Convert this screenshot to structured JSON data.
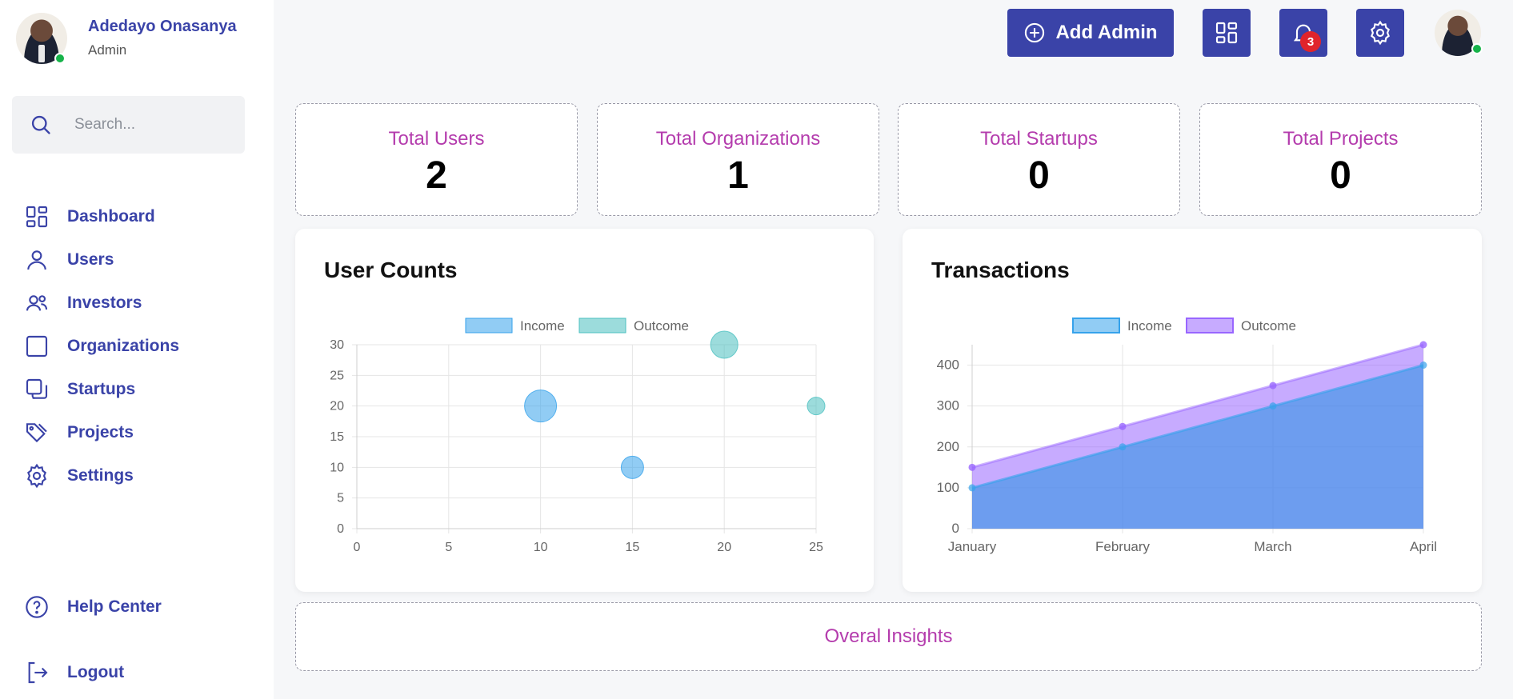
{
  "profile": {
    "name": "Adedayo Onasanya",
    "role": "Admin"
  },
  "search": {
    "placeholder": "Search..."
  },
  "nav": [
    {
      "label": "Dashboard",
      "icon": "dashboard-icon"
    },
    {
      "label": "Users",
      "icon": "user-icon"
    },
    {
      "label": "Investors",
      "icon": "investors-icon"
    },
    {
      "label": "Organizations",
      "icon": "square-icon"
    },
    {
      "label": "Startups",
      "icon": "copy-icon"
    },
    {
      "label": "Projects",
      "icon": "tags-icon"
    },
    {
      "label": "Settings",
      "icon": "gear-icon"
    }
  ],
  "bottom_nav": {
    "help": "Help Center",
    "logout": "Logout"
  },
  "topbar": {
    "add_admin": "Add Admin",
    "notification_count": "3"
  },
  "stats": [
    {
      "label": "Total Users",
      "value": "2"
    },
    {
      "label": "Total Organizations",
      "value": "1"
    },
    {
      "label": "Total Startups",
      "value": "0"
    },
    {
      "label": "Total Projects",
      "value": "0"
    }
  ],
  "insights": {
    "label": "Overal Insights"
  },
  "colors": {
    "accent": "#3a43a8",
    "magenta": "#b43cad",
    "income": "#36a2eb",
    "outcome": "#4bc0c0",
    "outcome_area": "#9966ff"
  },
  "chart_data": [
    {
      "type": "scatter",
      "title": "User Counts",
      "xlim": [
        0,
        25
      ],
      "ylim": [
        0,
        30
      ],
      "xticks": [
        0,
        5,
        10,
        15,
        20,
        25
      ],
      "yticks": [
        0,
        5,
        10,
        15,
        20,
        25,
        30
      ],
      "legend": "top-center",
      "grid": true,
      "series": [
        {
          "name": "Income",
          "points": [
            {
              "x": 10,
              "y": 20,
              "r": 20
            },
            {
              "x": 15,
              "y": 10,
              "r": 14
            }
          ]
        },
        {
          "name": "Outcome",
          "points": [
            {
              "x": 20,
              "y": 30,
              "r": 17
            },
            {
              "x": 25,
              "y": 20,
              "r": 11
            }
          ]
        }
      ]
    },
    {
      "type": "area",
      "title": "Transactions",
      "categories": [
        "January",
        "February",
        "March",
        "April"
      ],
      "ylim": [
        0,
        450
      ],
      "yticks": [
        0,
        100,
        200,
        300,
        400
      ],
      "stacked": true,
      "legend": "top-center",
      "grid": true,
      "series": [
        {
          "name": "Income",
          "values": [
            100,
            200,
            300,
            400
          ]
        },
        {
          "name": "Outcome",
          "values": [
            50,
            50,
            50,
            50
          ]
        }
      ]
    }
  ]
}
